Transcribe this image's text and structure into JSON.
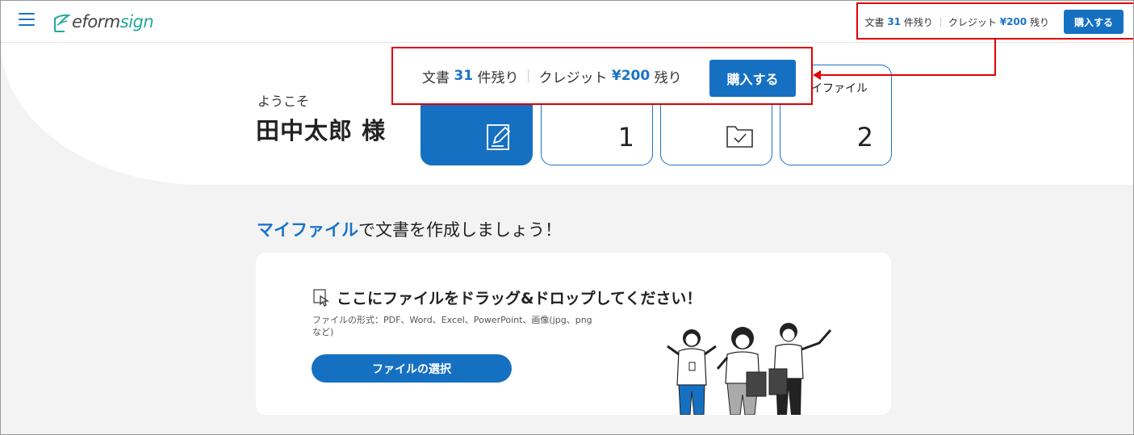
{
  "header": {
    "logo_prefix": "eform",
    "logo_suffix": "sign",
    "docs_label": "文書",
    "docs_count": "31",
    "docs_suffix": "件残り",
    "credit_label": "クレジット",
    "credit_amount": "¥200",
    "credit_suffix": "残り",
    "buy_label": "購入する"
  },
  "popup": {
    "docs_label": "文書",
    "docs_count": "31",
    "docs_suffix": "件残り",
    "credit_label": "クレジット",
    "credit_amount": "¥200",
    "credit_suffix": "残り",
    "buy_label": "購入する"
  },
  "welcome": {
    "greeting": "ようこそ",
    "user_name": "田中太郎 様"
  },
  "cards": [
    {
      "label": "",
      "count": ""
    },
    {
      "label": "",
      "count": "1"
    },
    {
      "label": "",
      "count": ""
    },
    {
      "label": "イファイル",
      "count": "2"
    }
  ],
  "section": {
    "title_accent": "マイファイル",
    "title_rest": "で文書を作成しましょう！"
  },
  "upload": {
    "drop_text": "ここにファイルをドラッグ&ドロップしてください！",
    "formats": "ファイルの形式：PDF、Word、Excel、PowerPoint、画像(jpg、png など)",
    "select_button": "ファイルの選択"
  },
  "colors": {
    "brand_blue": "#1670c2",
    "highlight_red": "#e00000",
    "logo_green": "#20a99a"
  }
}
